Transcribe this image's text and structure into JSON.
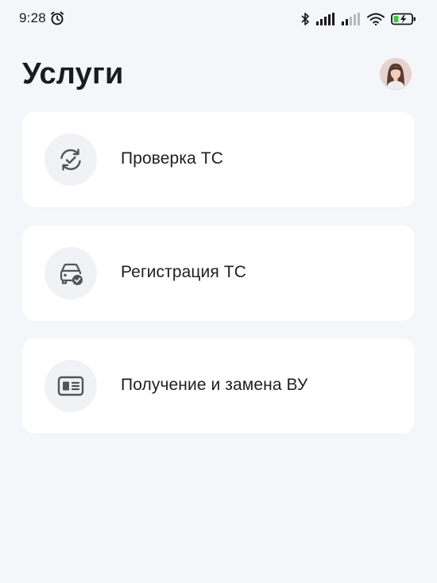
{
  "status_bar": {
    "time": "9:28"
  },
  "header": {
    "title": "Услуги"
  },
  "services": [
    {
      "label": "Проверка ТС",
      "icon": "refresh-check-icon"
    },
    {
      "label": "Регистрация ТС",
      "icon": "car-check-icon"
    },
    {
      "label": "Получение и замена ВУ",
      "icon": "license-card-icon"
    }
  ],
  "colors": {
    "background": "#f5f6fa",
    "card": "#ffffff",
    "icon_circle": "#f1f2f6",
    "icon_stroke": "#54545a",
    "battery_charge": "#3cc83c"
  }
}
